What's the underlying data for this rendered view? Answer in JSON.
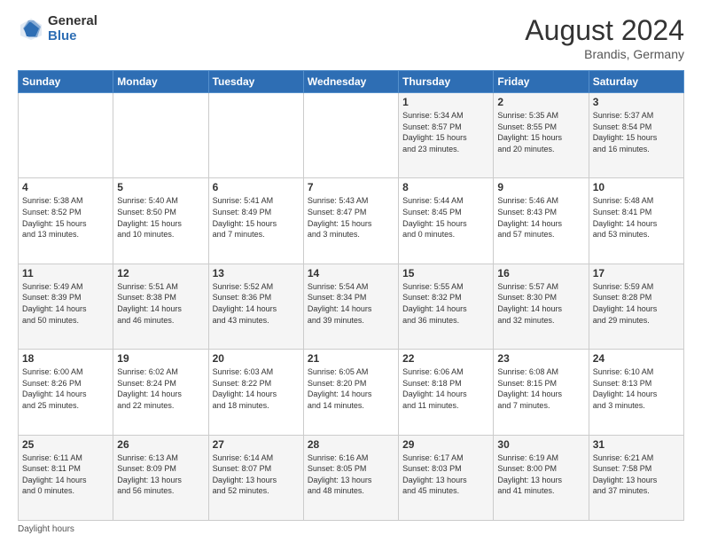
{
  "header": {
    "logo_general": "General",
    "logo_blue": "Blue",
    "title": "August 2024",
    "location": "Brandis, Germany"
  },
  "footer": {
    "note": "Daylight hours"
  },
  "days_of_week": [
    "Sunday",
    "Monday",
    "Tuesday",
    "Wednesday",
    "Thursday",
    "Friday",
    "Saturday"
  ],
  "weeks": [
    [
      {
        "day": "",
        "info": ""
      },
      {
        "day": "",
        "info": ""
      },
      {
        "day": "",
        "info": ""
      },
      {
        "day": "",
        "info": ""
      },
      {
        "day": "1",
        "info": "Sunrise: 5:34 AM\nSunset: 8:57 PM\nDaylight: 15 hours\nand 23 minutes."
      },
      {
        "day": "2",
        "info": "Sunrise: 5:35 AM\nSunset: 8:55 PM\nDaylight: 15 hours\nand 20 minutes."
      },
      {
        "day": "3",
        "info": "Sunrise: 5:37 AM\nSunset: 8:54 PM\nDaylight: 15 hours\nand 16 minutes."
      }
    ],
    [
      {
        "day": "4",
        "info": "Sunrise: 5:38 AM\nSunset: 8:52 PM\nDaylight: 15 hours\nand 13 minutes."
      },
      {
        "day": "5",
        "info": "Sunrise: 5:40 AM\nSunset: 8:50 PM\nDaylight: 15 hours\nand 10 minutes."
      },
      {
        "day": "6",
        "info": "Sunrise: 5:41 AM\nSunset: 8:49 PM\nDaylight: 15 hours\nand 7 minutes."
      },
      {
        "day": "7",
        "info": "Sunrise: 5:43 AM\nSunset: 8:47 PM\nDaylight: 15 hours\nand 3 minutes."
      },
      {
        "day": "8",
        "info": "Sunrise: 5:44 AM\nSunset: 8:45 PM\nDaylight: 15 hours\nand 0 minutes."
      },
      {
        "day": "9",
        "info": "Sunrise: 5:46 AM\nSunset: 8:43 PM\nDaylight: 14 hours\nand 57 minutes."
      },
      {
        "day": "10",
        "info": "Sunrise: 5:48 AM\nSunset: 8:41 PM\nDaylight: 14 hours\nand 53 minutes."
      }
    ],
    [
      {
        "day": "11",
        "info": "Sunrise: 5:49 AM\nSunset: 8:39 PM\nDaylight: 14 hours\nand 50 minutes."
      },
      {
        "day": "12",
        "info": "Sunrise: 5:51 AM\nSunset: 8:38 PM\nDaylight: 14 hours\nand 46 minutes."
      },
      {
        "day": "13",
        "info": "Sunrise: 5:52 AM\nSunset: 8:36 PM\nDaylight: 14 hours\nand 43 minutes."
      },
      {
        "day": "14",
        "info": "Sunrise: 5:54 AM\nSunset: 8:34 PM\nDaylight: 14 hours\nand 39 minutes."
      },
      {
        "day": "15",
        "info": "Sunrise: 5:55 AM\nSunset: 8:32 PM\nDaylight: 14 hours\nand 36 minutes."
      },
      {
        "day": "16",
        "info": "Sunrise: 5:57 AM\nSunset: 8:30 PM\nDaylight: 14 hours\nand 32 minutes."
      },
      {
        "day": "17",
        "info": "Sunrise: 5:59 AM\nSunset: 8:28 PM\nDaylight: 14 hours\nand 29 minutes."
      }
    ],
    [
      {
        "day": "18",
        "info": "Sunrise: 6:00 AM\nSunset: 8:26 PM\nDaylight: 14 hours\nand 25 minutes."
      },
      {
        "day": "19",
        "info": "Sunrise: 6:02 AM\nSunset: 8:24 PM\nDaylight: 14 hours\nand 22 minutes."
      },
      {
        "day": "20",
        "info": "Sunrise: 6:03 AM\nSunset: 8:22 PM\nDaylight: 14 hours\nand 18 minutes."
      },
      {
        "day": "21",
        "info": "Sunrise: 6:05 AM\nSunset: 8:20 PM\nDaylight: 14 hours\nand 14 minutes."
      },
      {
        "day": "22",
        "info": "Sunrise: 6:06 AM\nSunset: 8:18 PM\nDaylight: 14 hours\nand 11 minutes."
      },
      {
        "day": "23",
        "info": "Sunrise: 6:08 AM\nSunset: 8:15 PM\nDaylight: 14 hours\nand 7 minutes."
      },
      {
        "day": "24",
        "info": "Sunrise: 6:10 AM\nSunset: 8:13 PM\nDaylight: 14 hours\nand 3 minutes."
      }
    ],
    [
      {
        "day": "25",
        "info": "Sunrise: 6:11 AM\nSunset: 8:11 PM\nDaylight: 14 hours\nand 0 minutes."
      },
      {
        "day": "26",
        "info": "Sunrise: 6:13 AM\nSunset: 8:09 PM\nDaylight: 13 hours\nand 56 minutes."
      },
      {
        "day": "27",
        "info": "Sunrise: 6:14 AM\nSunset: 8:07 PM\nDaylight: 13 hours\nand 52 minutes."
      },
      {
        "day": "28",
        "info": "Sunrise: 6:16 AM\nSunset: 8:05 PM\nDaylight: 13 hours\nand 48 minutes."
      },
      {
        "day": "29",
        "info": "Sunrise: 6:17 AM\nSunset: 8:03 PM\nDaylight: 13 hours\nand 45 minutes."
      },
      {
        "day": "30",
        "info": "Sunrise: 6:19 AM\nSunset: 8:00 PM\nDaylight: 13 hours\nand 41 minutes."
      },
      {
        "day": "31",
        "info": "Sunrise: 6:21 AM\nSunset: 7:58 PM\nDaylight: 13 hours\nand 37 minutes."
      }
    ]
  ]
}
